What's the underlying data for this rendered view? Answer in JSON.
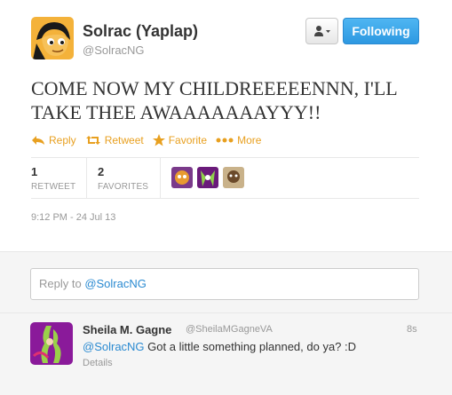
{
  "tweet": {
    "author": {
      "name": "Solrac (Yaplap)",
      "handle": "@SolracNG"
    },
    "text": "COME NOW MY CHILDREEEEENNN, I'LL TAKE THEE AWAAAAAAAYYY!!",
    "follow_label": "Following",
    "actions": {
      "reply": "Reply",
      "retweet": "Retweet",
      "favorite": "Favorite",
      "more": "More"
    },
    "stats": {
      "retweet_count": "1",
      "retweet_label": "RETWEET",
      "favorites_count": "2",
      "favorites_label": "FAVORITES"
    },
    "timestamp": "9:12 PM - 24 Jul 13"
  },
  "reply_box": {
    "prefix": "Reply to ",
    "mention": "@SolracNG"
  },
  "reply": {
    "author": {
      "name": "Sheila M. Gagne",
      "handle": "@SheilaMGagneVA"
    },
    "time": "8s",
    "mention": "@SolracNG",
    "text": " Got a little something planned, do ya? :D",
    "details": "Details"
  },
  "colors": {
    "accent": "#2a8ad1",
    "action": "#e8a020",
    "follow_button": "#2d98e1"
  }
}
